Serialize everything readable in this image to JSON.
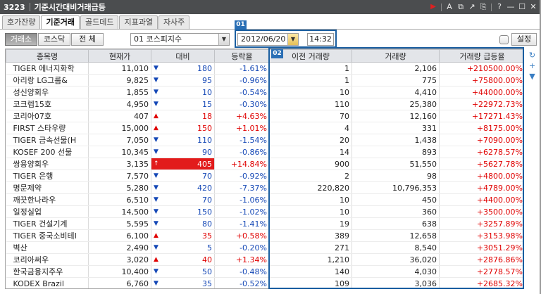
{
  "window": {
    "code": "3223",
    "title": "기준시간대비거래급등",
    "icons": [
      "play-icon",
      "font-icon",
      "export-icon",
      "popout-icon",
      "settings-icon",
      "help-icon",
      "minimize-icon",
      "maximize-icon",
      "close-icon"
    ],
    "glyphs": [
      "▶",
      "A",
      "⧉",
      "↗",
      "⎘",
      "?",
      "—",
      "☐",
      "✕"
    ]
  },
  "tabs": [
    "호가잔량",
    "기준거래",
    "골드데드",
    "지표과열",
    "자사주"
  ],
  "active_tab": 1,
  "toolbar": {
    "market_buttons": [
      "거래소",
      "코스닥",
      "전 체"
    ],
    "index_select": "01  코스피지수",
    "date_value": "2012/06/20",
    "time_value": "14:32",
    "badge1": "01",
    "badge2": "02",
    "settings_label": "설정"
  },
  "table": {
    "headers": [
      "종목명",
      "현재가",
      "대비",
      "등락율",
      "이전 거래량",
      "거래량",
      "거래량 급등율"
    ],
    "rows": [
      {
        "name": "TIGER 에너지화학",
        "price": "11,010",
        "dir": "down",
        "diff": "180",
        "rate": "-1.61%",
        "prev_vol": "1",
        "vol": "2,106",
        "surge": "+210500.00%"
      },
      {
        "name": "아리랑 LG그룹&",
        "price": "9,825",
        "dir": "down",
        "diff": "95",
        "rate": "-0.96%",
        "prev_vol": "1",
        "vol": "775",
        "surge": "+75800.00%"
      },
      {
        "name": "성신양회우",
        "price": "1,855",
        "dir": "down",
        "diff": "10",
        "rate": "-0.54%",
        "prev_vol": "10",
        "vol": "4,410",
        "surge": "+44000.00%"
      },
      {
        "name": "코크렙15호",
        "price": "4,950",
        "dir": "down",
        "diff": "15",
        "rate": "-0.30%",
        "prev_vol": "110",
        "vol": "25,380",
        "surge": "+22972.73%"
      },
      {
        "name": "코리아07호",
        "price": "407",
        "dir": "up",
        "diff": "18",
        "rate": "+4.63%",
        "prev_vol": "70",
        "vol": "12,160",
        "surge": "+17271.43%"
      },
      {
        "name": "FIRST 스타우량",
        "price": "15,000",
        "dir": "up",
        "diff": "150",
        "rate": "+1.01%",
        "prev_vol": "4",
        "vol": "331",
        "surge": "+8175.00%"
      },
      {
        "name": "TIGER 금속선물(H",
        "price": "7,050",
        "dir": "down",
        "diff": "110",
        "rate": "-1.54%",
        "prev_vol": "20",
        "vol": "1,438",
        "surge": "+7090.00%"
      },
      {
        "name": "KOSEF 200 선물",
        "price": "10,345",
        "dir": "down",
        "diff": "90",
        "rate": "-0.86%",
        "prev_vol": "14",
        "vol": "893",
        "surge": "+6278.57%"
      },
      {
        "name": "쌍용양회우",
        "price": "3,135",
        "dir": "limit",
        "diff": "405",
        "rate": "+14.84%",
        "prev_vol": "900",
        "vol": "51,550",
        "surge": "+5627.78%"
      },
      {
        "name": "TIGER 은행",
        "price": "7,570",
        "dir": "down",
        "diff": "70",
        "rate": "-0.92%",
        "prev_vol": "2",
        "vol": "98",
        "surge": "+4800.00%"
      },
      {
        "name": "명문제약",
        "price": "5,280",
        "dir": "down",
        "diff": "420",
        "rate": "-7.37%",
        "prev_vol": "220,820",
        "vol": "10,796,353",
        "surge": "+4789.00%"
      },
      {
        "name": "깨끗한나라우",
        "price": "6,510",
        "dir": "down",
        "diff": "70",
        "rate": "-1.06%",
        "prev_vol": "10",
        "vol": "450",
        "surge": "+4400.00%"
      },
      {
        "name": "일정실업",
        "price": "14,500",
        "dir": "down",
        "diff": "150",
        "rate": "-1.02%",
        "prev_vol": "10",
        "vol": "360",
        "surge": "+3500.00%"
      },
      {
        "name": "TIGER 건설기계",
        "price": "5,595",
        "dir": "down",
        "diff": "80",
        "rate": "-1.41%",
        "prev_vol": "19",
        "vol": "638",
        "surge": "+3257.89%"
      },
      {
        "name": "TIGER 중국소비테I",
        "price": "6,100",
        "dir": "up",
        "diff": "35",
        "rate": "+0.58%",
        "prev_vol": "389",
        "vol": "12,658",
        "surge": "+3153.98%"
      },
      {
        "name": "벽산",
        "price": "2,490",
        "dir": "down",
        "diff": "5",
        "rate": "-0.20%",
        "prev_vol": "271",
        "vol": "8,540",
        "surge": "+3051.29%"
      },
      {
        "name": "코리아써우",
        "price": "3,020",
        "dir": "up",
        "diff": "40",
        "rate": "+1.34%",
        "prev_vol": "1,210",
        "vol": "36,020",
        "surge": "+2876.86%"
      },
      {
        "name": "한국금융지주우",
        "price": "10,400",
        "dir": "down",
        "diff": "50",
        "rate": "-0.48%",
        "prev_vol": "140",
        "vol": "4,030",
        "surge": "+2778.57%"
      },
      {
        "name": "KODEX Brazil",
        "price": "6,760",
        "dir": "down",
        "diff": "35",
        "rate": "-0.52%",
        "prev_vol": "109",
        "vol": "3,036",
        "surge": "+2685.32%"
      }
    ]
  },
  "side_icons": {
    "names": [
      "refresh-icon",
      "add-icon",
      "scroll-down-icon"
    ],
    "glyphs": [
      "↻",
      "+",
      "▼"
    ]
  }
}
